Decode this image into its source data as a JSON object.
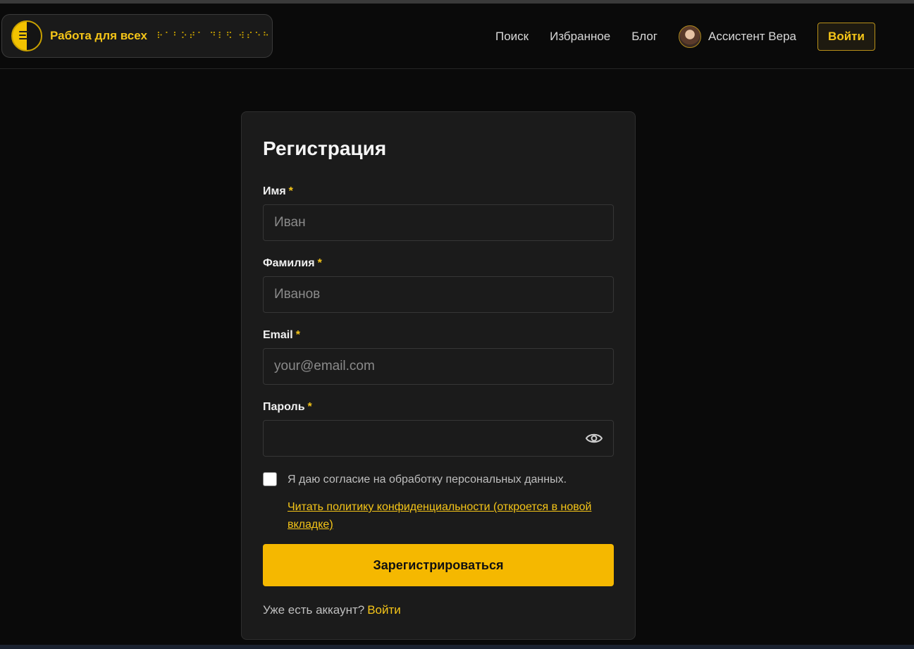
{
  "header": {
    "brand_name": "Работа для всех",
    "brand_braille": "⠗⠁⠃⠕⠞⠁ ⠙⠇⠫ ⠺⠎⠑⠓",
    "nav": {
      "search": "Поиск",
      "favorites": "Избранное",
      "blog": "Блог",
      "assistant": "Ассистент Вера"
    },
    "login_label": "Войти"
  },
  "form": {
    "title": "Регистрация",
    "required_mark": "*",
    "first_name": {
      "label": "Имя",
      "placeholder": "Иван",
      "value": ""
    },
    "last_name": {
      "label": "Фамилия",
      "placeholder": "Иванов",
      "value": ""
    },
    "email": {
      "label": "Email",
      "placeholder": "your@email.com",
      "value": ""
    },
    "password": {
      "label": "Пароль",
      "value": ""
    },
    "consent": {
      "checked": false,
      "text": "Я даю согласие на обработку персональных данных.",
      "policy_link": "Читать политику конфиденциальности (откроется в новой вкладке)"
    },
    "submit_label": "Зарегистрироваться",
    "footer_text": "Уже есть аккаунт?",
    "footer_link": "Войти"
  },
  "colors": {
    "accent": "#f5c518",
    "button": "#f5b800",
    "background": "#0a0a0a",
    "card": "#1b1b1b"
  }
}
